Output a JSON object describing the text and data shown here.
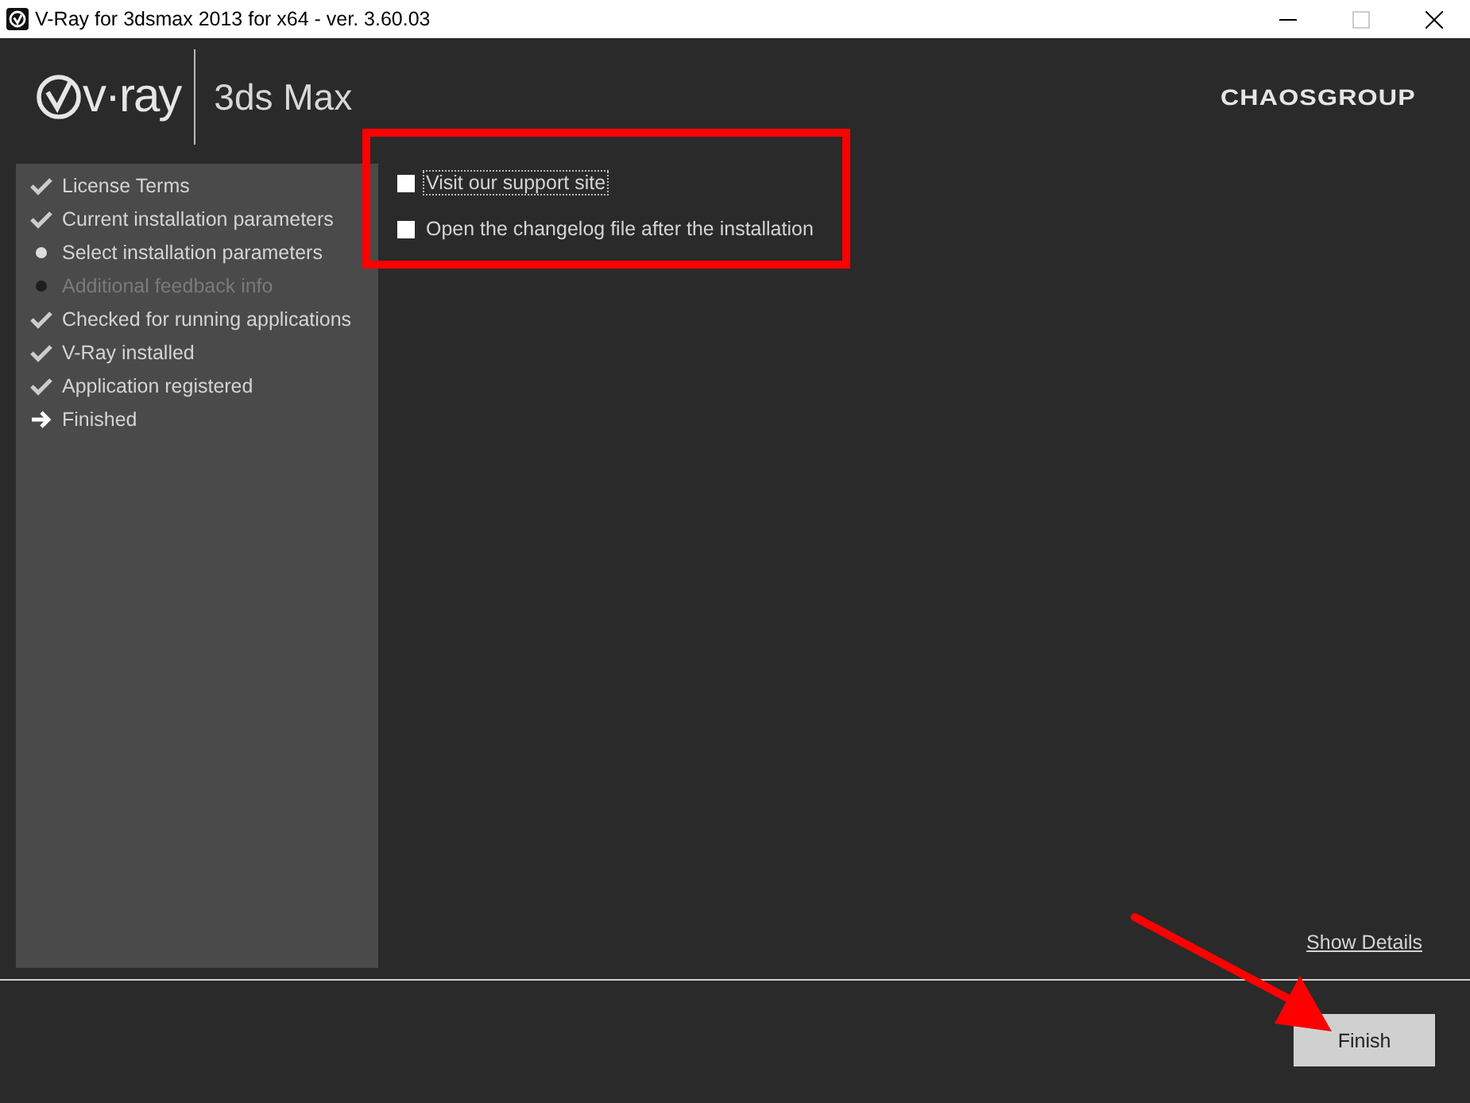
{
  "window": {
    "title": "V-Ray for 3dsmax 2013 for x64 - ver. 3.60.03"
  },
  "header": {
    "logo": "v·ray",
    "product": "3ds Max",
    "brand": "CHAOSGROUP"
  },
  "steps": [
    {
      "label": "License Terms",
      "kind": "done"
    },
    {
      "label": "Current installation parameters",
      "kind": "done"
    },
    {
      "label": "Select installation parameters",
      "kind": "skipped"
    },
    {
      "label": "Additional feedback info",
      "kind": "pending"
    },
    {
      "label": "Checked for running applications",
      "kind": "done"
    },
    {
      "label": "V-Ray installed",
      "kind": "done"
    },
    {
      "label": "Application registered",
      "kind": "done"
    },
    {
      "label": "Finished",
      "kind": "current"
    }
  ],
  "options": [
    {
      "label": "Visit our support site",
      "checked": false,
      "focused": true
    },
    {
      "label": "Open the changelog file after the installation",
      "checked": false,
      "focused": false
    }
  ],
  "show_details": "Show Details",
  "finish_button": "Finish",
  "annotations": {
    "highlight_box": {
      "color": "#ff0000"
    },
    "arrow": {
      "color": "#ff0000"
    }
  }
}
